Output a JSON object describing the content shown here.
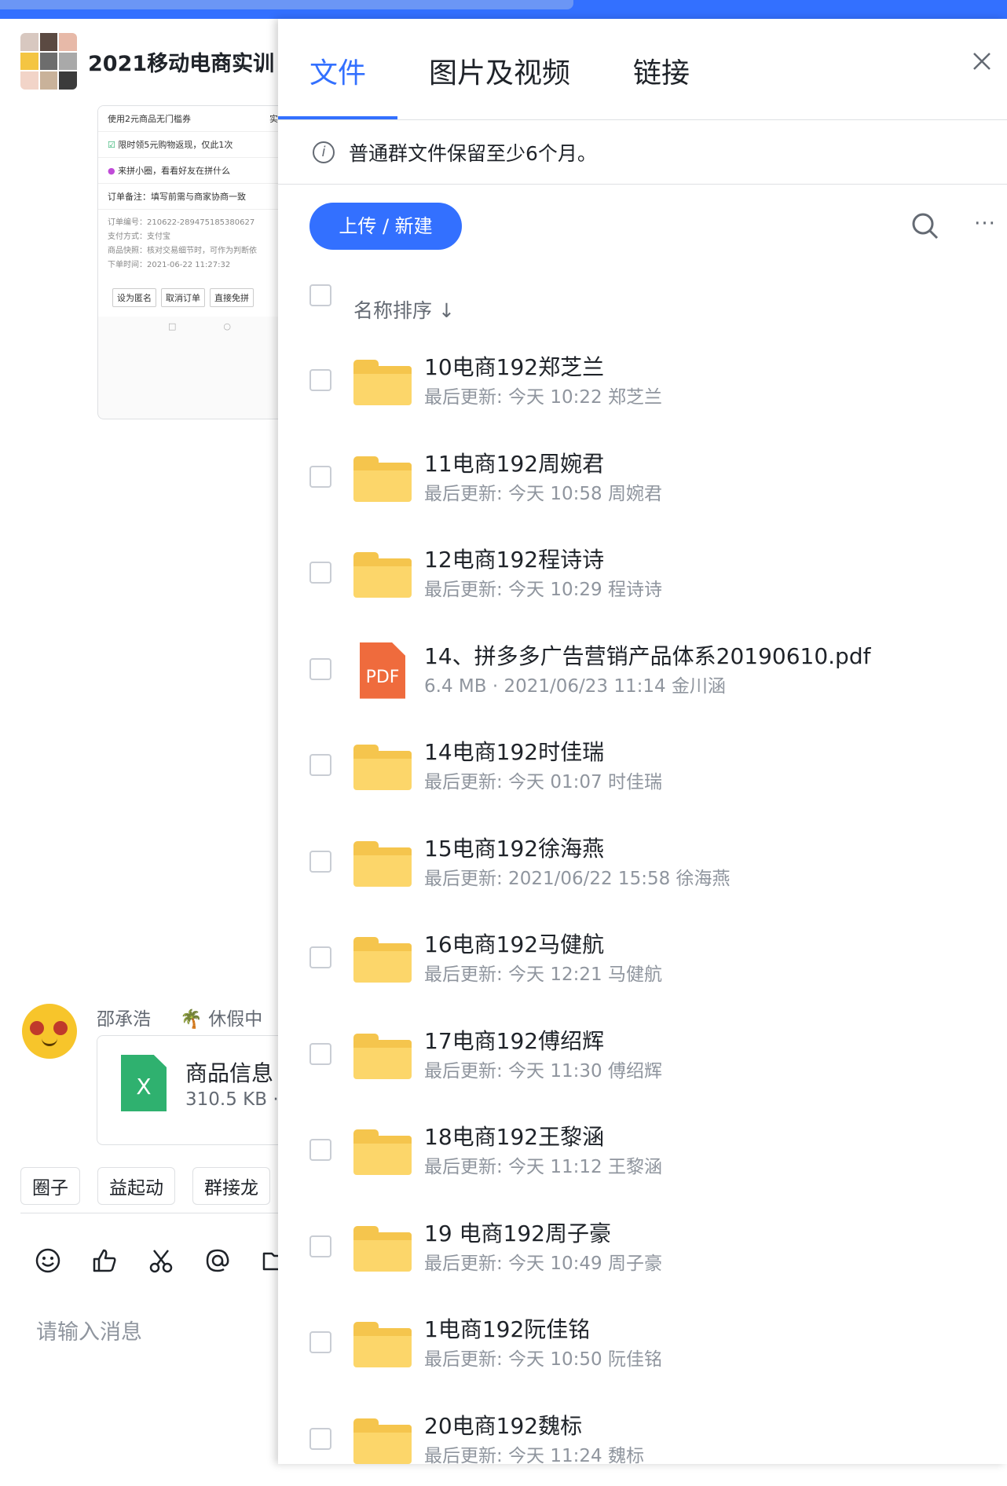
{
  "chat": {
    "title": "2021移动电商实训",
    "preview": {
      "row1": "使用2元商品无门槛券",
      "row1_right": "实付",
      "row2": "限时领5元购物返现，仅此1次",
      "row3": "来拼小圈，看看好友在拼什么",
      "row4": "订单备注：填写前需与商家协商一致",
      "details": [
        "订单编号：210622-289475185380627",
        "支付方式：支付宝",
        "商品快照：核对交易细节时，可作为判断依",
        "下单时间：2021-06-22 11:27:32"
      ],
      "buttons": [
        "设为匿名",
        "取消订单",
        "直接免拼"
      ]
    },
    "message": {
      "sender": "邵承浩",
      "status": "🌴 休假中",
      "file_name": "商品信息",
      "file_icon_label": "X",
      "file_size": "310.5 KB ·"
    },
    "quick_actions": [
      "圈子",
      "益起动",
      "群接龙"
    ],
    "input_placeholder": "请输入消息"
  },
  "panel": {
    "tabs": [
      "文件",
      "图片及视频",
      "链接"
    ],
    "active_tab": "文件",
    "notice": "普通群文件保留至少6个月。",
    "upload_label": "上传 / 新建",
    "sort_label": "名称排序 ↓",
    "files": [
      {
        "type": "folder",
        "name": "10电商192郑芝兰",
        "meta": "最后更新: 今天 10:22  郑芝兰"
      },
      {
        "type": "folder",
        "name": "11电商192周婉君",
        "meta": "最后更新: 今天 10:58  周婉君"
      },
      {
        "type": "folder",
        "name": "12电商192程诗诗",
        "meta": "最后更新: 今天 10:29  程诗诗"
      },
      {
        "type": "pdf",
        "name": "14、拼多多广告营销产品体系20190610.pdf",
        "meta": "6.4 MB  ·  2021/06/23 11:14  金川涵",
        "icon_label": "PDF"
      },
      {
        "type": "folder",
        "name": "14电商192时佳瑞",
        "meta": "最后更新: 今天 01:07  时佳瑞"
      },
      {
        "type": "folder",
        "name": "15电商192徐海燕",
        "meta": "最后更新: 2021/06/22 15:58  徐海燕"
      },
      {
        "type": "folder",
        "name": "16电商192马健航",
        "meta": "最后更新: 今天 12:21  马健航"
      },
      {
        "type": "folder",
        "name": "17电商192傅绍辉",
        "meta": "最后更新: 今天 11:30  傅绍辉"
      },
      {
        "type": "folder",
        "name": "18电商192王黎涵",
        "meta": "最后更新: 今天 11:12  王黎涵"
      },
      {
        "type": "folder",
        "name": "19 电商192周子豪",
        "meta": "最后更新: 今天 10:49  周子豪"
      },
      {
        "type": "folder",
        "name": "1电商192阮佳铭",
        "meta": "最后更新: 今天 10:50  阮佳铭"
      },
      {
        "type": "folder",
        "name": "20电商192魏标",
        "meta": "最后更新: 今天 11:24  魏标"
      }
    ]
  },
  "colors": {
    "accent": "#3370ff",
    "folder": "#fcd66a",
    "pdf": "#ef6b3d",
    "excel": "#2fb16f"
  }
}
